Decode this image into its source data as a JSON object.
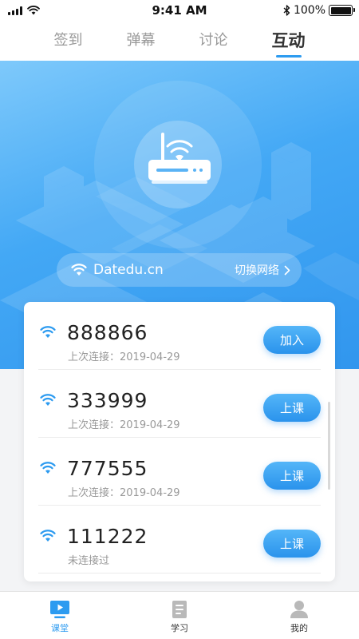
{
  "status_bar": {
    "time": "9:41 AM",
    "battery": "100%",
    "battery_level": 1.0
  },
  "top_tabs": [
    {
      "label": "签到",
      "active": false
    },
    {
      "label": "弹幕",
      "active": false
    },
    {
      "label": "讨论",
      "active": false
    },
    {
      "label": "互动",
      "active": true
    }
  ],
  "network": {
    "name": "Datedu.cn",
    "switch_label": "切换网络 "
  },
  "classes": [
    {
      "code": "888866",
      "status": "上次连接：2019-04-29",
      "action": "加入"
    },
    {
      "code": "333999",
      "status": "上次连接：2019-04-29",
      "action": "上课"
    },
    {
      "code": "777555",
      "status": "上次连接：2019-04-29",
      "action": "上课"
    },
    {
      "code": "111222",
      "status": "未连接过",
      "action": "上课"
    }
  ],
  "bottom_nav": [
    {
      "label": "课堂",
      "icon": "classroom-play-icon",
      "active": true
    },
    {
      "label": "学习",
      "icon": "notebook-icon",
      "active": false
    },
    {
      "label": "我的",
      "icon": "person-icon",
      "active": false
    }
  ],
  "colors": {
    "accent": "#2d9bf0",
    "hero_top": "#7ec9fb",
    "hero_bottom": "#3196ee"
  }
}
